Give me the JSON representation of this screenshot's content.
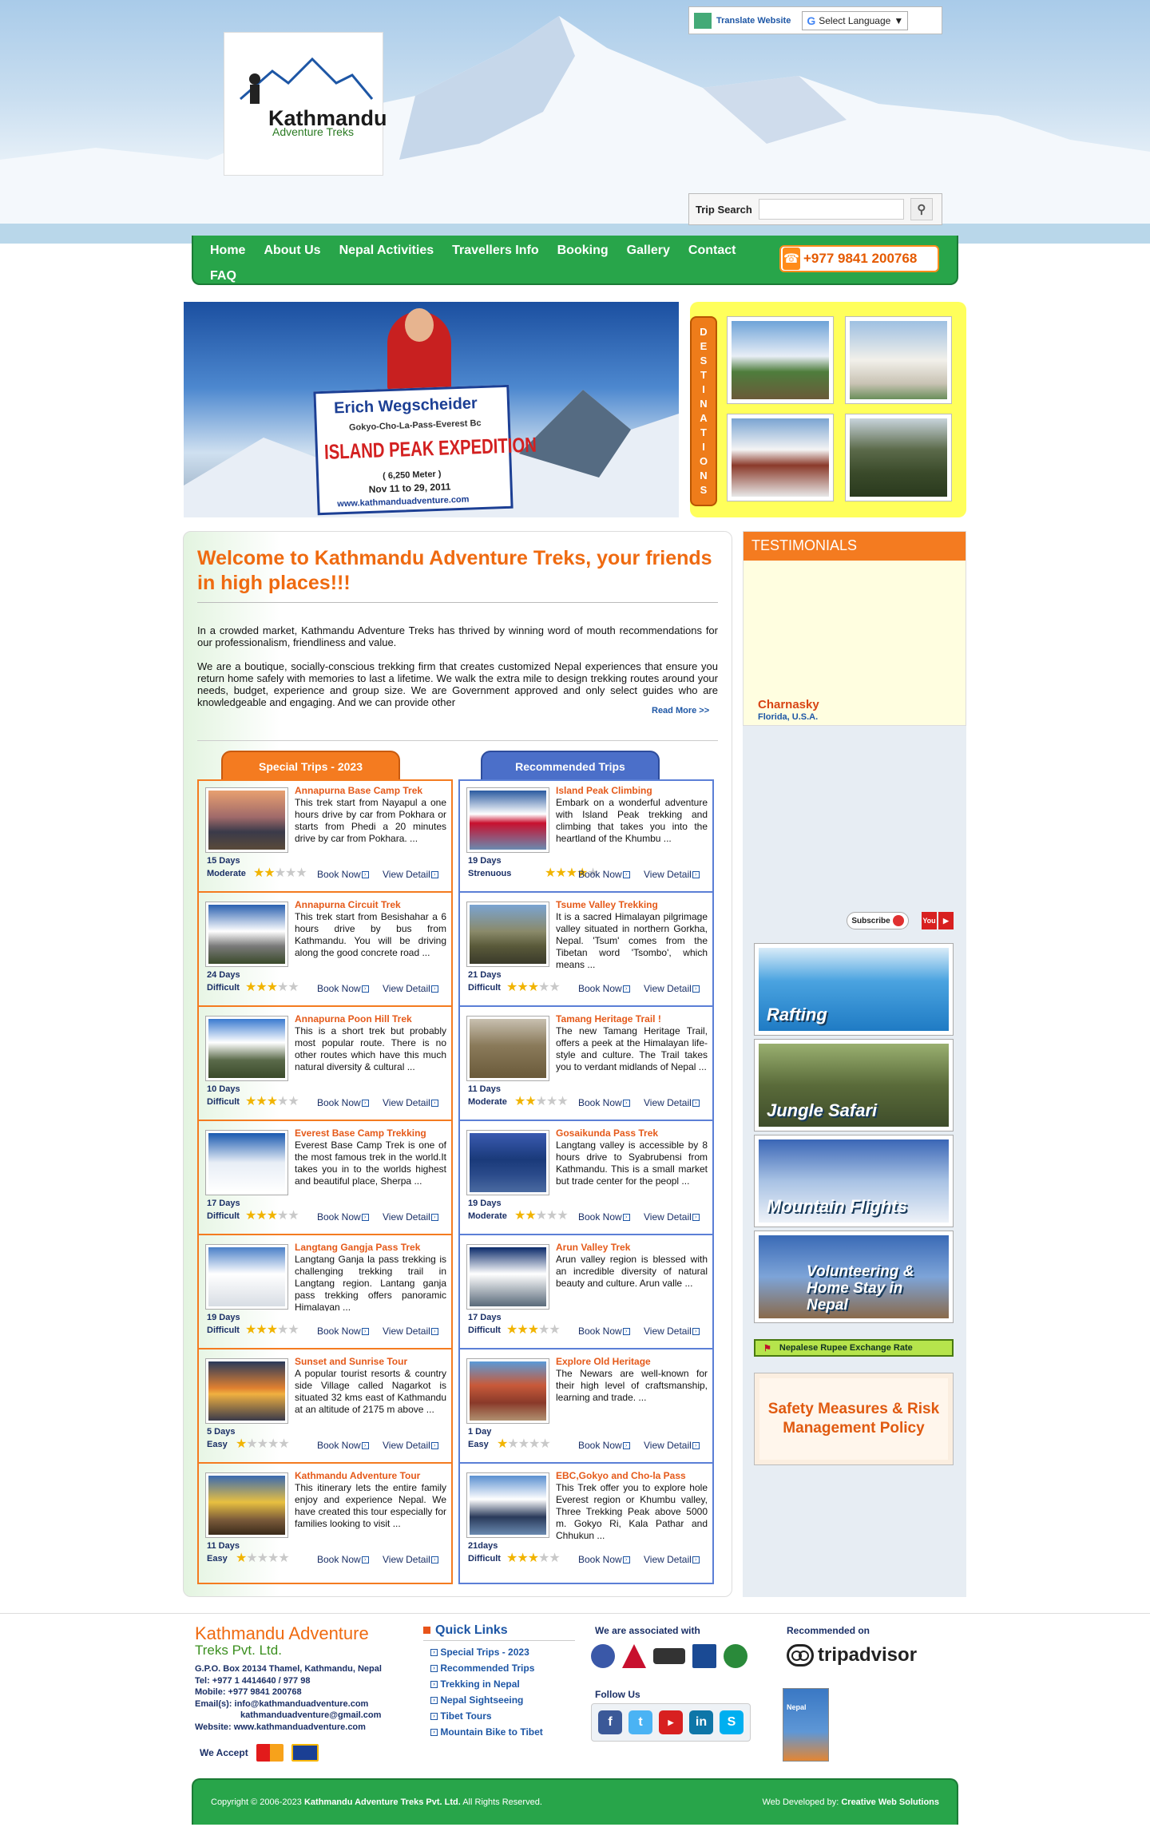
{
  "header": {
    "logo": {
      "word": "Kathmandu",
      "tagline": "Adventure Treks"
    },
    "translate": {
      "label": "Translate Website",
      "select_label": "Select Language"
    },
    "trip_search": {
      "label": "Trip Search",
      "placeholder": ""
    }
  },
  "nav": {
    "items": [
      "Home",
      "About Us",
      "Nepal Activities",
      "Travellers Info",
      "Booking",
      "Gallery",
      "Contact",
      "FAQ"
    ],
    "phone": "+977 9841 200768"
  },
  "banner": {
    "name": "Erich Wegscheider",
    "route": "Gokyo-Cho-La-Pass-Everest Bc",
    "expedition": "ISLAND PEAK EXPEDITION",
    "height": "( 6,250 Meter )",
    "dates": "Nov 11 to 29, 2011",
    "site": "www.kathmanduadventure.com"
  },
  "destinations": {
    "tab_letters": [
      "D",
      "E",
      "S",
      "T",
      "I",
      "N",
      "A",
      "T",
      "I",
      "O",
      "N",
      "S"
    ]
  },
  "welcome": {
    "title": "Welcome to Kathmandu Adventure Treks, your friends in high places!!!",
    "para1": "In a crowded market, Kathmandu Adventure Treks has thrived by winning word of mouth recommendations for our professionalism, friendliness and value.",
    "para2": "We are a boutique, socially-conscious trekking firm that creates customized Nepal experiences that ensure you return home safely with memories to last a lifetime. We walk the extra mile to design trekking routes around your needs, budget, experience and group size. We are Government approved and only select guides who are knowledgeable and engaging. And we can provide other",
    "read_more": "Read More >>"
  },
  "tabs": {
    "special": "Special Trips - 2023",
    "recommended": "Recommended Trips"
  },
  "labels": {
    "book": "Book Now",
    "view": "View Detail"
  },
  "special_trips": [
    {
      "title": "Annapurna Base Camp Trek",
      "desc": "This trek start from Nayapul a one hours drive by car from Pokhara or starts from Phedi a 20 minutes drive by car from Pokhara. ...",
      "days": "15 Days",
      "level": "Moderate",
      "stars": 2
    },
    {
      "title": "Annapurna Circuit Trek",
      "desc": "This trek start from Besishahar a 6 hours drive by bus from Kathmandu. You will be driving along the good concrete road ...",
      "days": "24 Days",
      "level": "Difficult",
      "stars": 3
    },
    {
      "title": "Annapurna Poon Hill Trek",
      "desc": "This is a short trek but probably most popular route. There is no other routes which have this much natural diversity & cultural ...",
      "days": "10 Days",
      "level": "Difficult",
      "stars": 3
    },
    {
      "title": "Everest Base Camp Trekking",
      "desc": "Everest Base Camp Trek is one of the most famous trek in the world.It takes you in to the worlds highest and beautiful place, Sherpa ...",
      "days": "17 Days",
      "level": "Difficult",
      "stars": 3
    },
    {
      "title": "Langtang Gangja Pass Trek",
      "desc": "Langtang Ganja la pass trekking is challenging trekking trail in Langtang region. Lantang ganja pass trekking offers panoramic Himalayan ...",
      "days": "19 Days",
      "level": "Difficult",
      "stars": 3
    },
    {
      "title": "Sunset and Sunrise Tour",
      "desc": "A popular tourist resorts & country side Village called Nagarkot is situated 32 kms east of Kathmandu at an altitude of 2175 m above ...",
      "days": "5 Days",
      "level": "Easy",
      "stars": 1
    },
    {
      "title": "Kathmandu Adventure Tour",
      "desc": "This itinerary lets the entire family enjoy and experience Nepal. We have created this tour especially for families looking to visit ...",
      "days": "11 Days",
      "level": "Easy",
      "stars": 1
    }
  ],
  "recommended_trips": [
    {
      "title": "Island Peak Climbing",
      "desc": "Embark on a wonderful adventure with Island Peak trekking and climbing that takes you into the heartland of the Khumbu ...",
      "days": "19 Days",
      "level": "Strenuous",
      "stars": 4
    },
    {
      "title": "Tsume Valley Trekking",
      "desc": "It is a sacred Himalayan pilgrimage valley situated in northern Gorkha, Nepal. 'Tsum' comes from the Tibetan word 'Tsombo', which means ...",
      "days": "21 Days",
      "level": "Difficult",
      "stars": 3
    },
    {
      "title": "Tamang Heritage Trail !",
      "desc": "The new Tamang Heritage Trail, offers a peek at the Himalayan life-style and culture. The Trail takes you to verdant midlands of Nepal ...",
      "days": "11 Days",
      "level": "Moderate",
      "stars": 2
    },
    {
      "title": "Gosaikunda Pass Trek",
      "desc": "Langtang valley is accessible by 8 hours drive to Syabrubensi from Kathmandu. This is a small market but trade center for the peopl ...",
      "days": "19 Days",
      "level": "Moderate",
      "stars": 2
    },
    {
      "title": "Arun Valley Trek",
      "desc": "Arun valley region is blessed with an incredible diversity of natural beauty and culture. Arun valle ...",
      "days": "17 Days",
      "level": "Difficult",
      "stars": 3
    },
    {
      "title": "Explore Old Heritage",
      "desc": "The Newars are well-known for their high level of craftsmanship, learning and trade. ...",
      "days": "1 Day",
      "level": "Easy",
      "stars": 1
    },
    {
      "title": "EBC,Gokyo and Cho-la Pass",
      "desc": "This Trek offer you to explore hole Everest region or Khumbu valley, Three Trekking Peak above 5000 m. Gokyo Ri, Kala Pathar and Chhukun ...",
      "days": "21days",
      "level": "Difficult",
      "stars": 3
    }
  ],
  "sidebar": {
    "testimonials_title": "TESTIMONIALS",
    "testimonial_name": "Charnasky",
    "testimonial_location": "Florida, U.S.A.",
    "subscribe": "Subscribe",
    "youtube_you": "You",
    "youtube_tube": "Tube",
    "activities": [
      "Rafting",
      "Jungle Safari",
      "Mountain Flights",
      "Volunteering & Home Stay in Nepal"
    ],
    "rupee": "Nepalese Rupee Exchange Rate",
    "safety": "Safety Measures & Risk Management Policy"
  },
  "footer": {
    "company1": "Kathmandu Adventure",
    "company2": "Treks Pvt. Ltd.",
    "address": "G.P.O. Box 20134 Thamel, Kathmandu, Nepal",
    "tel": "Tel: +977 1 4414640 / 977 98",
    "mobile": "Mobile: +977 9841 200768",
    "email1": "Email(s):  info@kathmanduadventure.com",
    "email2": "kathmanduadventure@gmail.com",
    "website": "Website: www.kathmanduadventure.com",
    "we_accept": "We Accept",
    "quick_links_title": "Quick Links",
    "quick_links": [
      "Special Trips - 2023",
      "Recommended Trips",
      "Trekking in Nepal",
      "Nepal Sightseeing",
      "Tibet Tours",
      "Mountain Bike to Tibet"
    ],
    "associated": "We are associated with",
    "follow": "Follow Us",
    "recommended_on": "Recommended on",
    "tripadvisor": "tripadvisor",
    "book_label": "Nepal",
    "copyright_pre": "Copyright © 2006-2023",
    "copyright_company": "Kathmandu Adventure Treks Pvt. Ltd.",
    "copyright_post": "All Rights Reserved.",
    "dev_pre": "Web Developed by:",
    "dev_name": "Creative Web Solutions"
  },
  "colors": {
    "green": "#28a54a",
    "orange": "#f47b20",
    "blue": "#4b6fc9",
    "yellow": "#ffff5b"
  }
}
